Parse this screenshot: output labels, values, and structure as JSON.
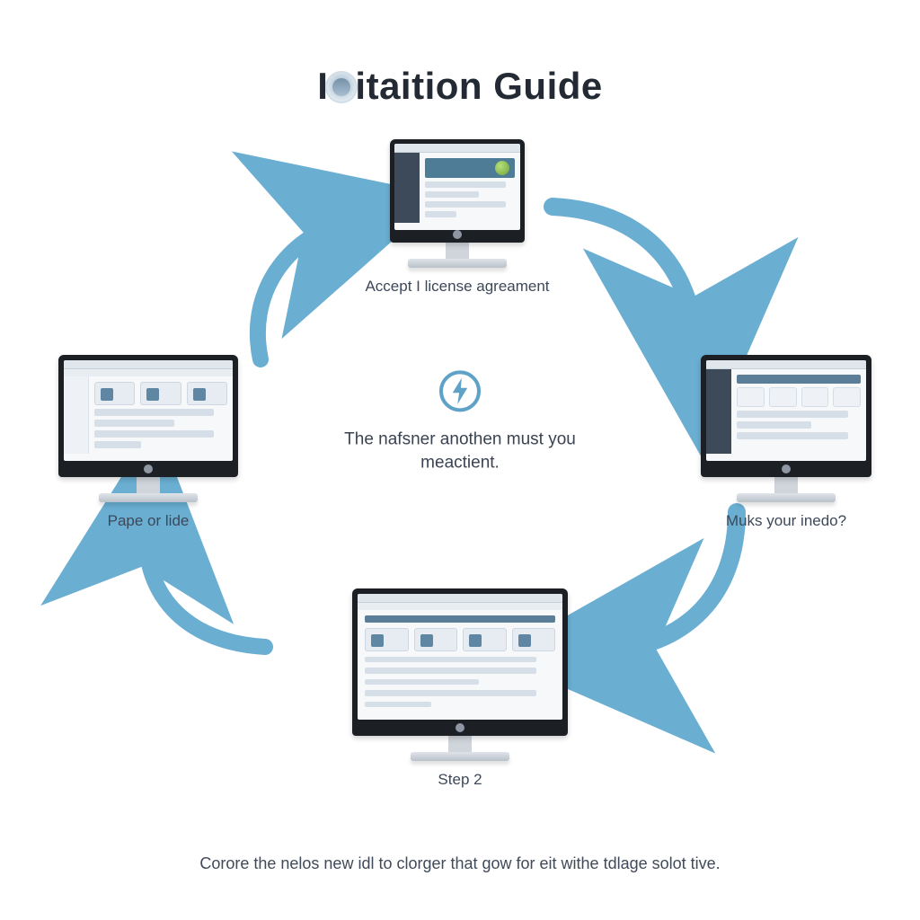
{
  "title_prefix": "I",
  "title_suffix": "itaition Guide",
  "center_text": "The nafsner anothen must you meactient.",
  "nodes": {
    "top": {
      "caption": "Accept I license agreament"
    },
    "left": {
      "caption": "Pape or lide"
    },
    "right": {
      "caption": "Muks your inedo?"
    },
    "bottom": {
      "caption": "Step 2"
    }
  },
  "footer": "Corore the nelos new idl to clorger that gow for eit withe tdlage solot tive.",
  "colors": {
    "arrow": "#6aaed2",
    "accent": "#5fa2c8"
  },
  "diagram_flow": [
    "left",
    "top",
    "right",
    "bottom",
    "left"
  ],
  "diagram_type": "circular-process"
}
